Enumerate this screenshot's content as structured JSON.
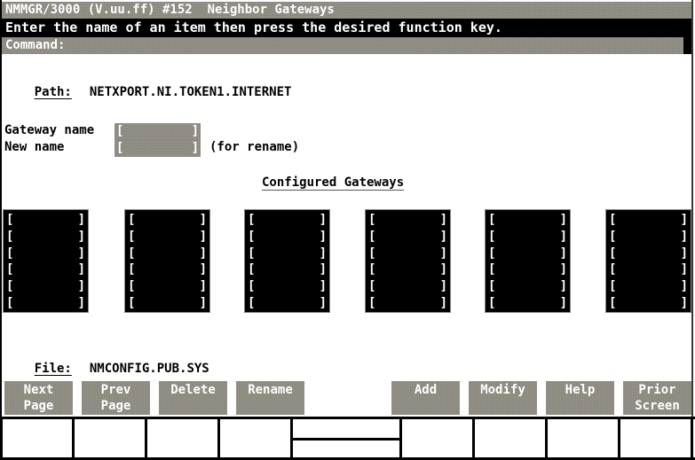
{
  "header": {
    "title": "NMMGR/3000 (V.uu.ff) #152  Neighbor Gateways",
    "message": "Enter the name of an item then press the desired function key.",
    "command_label": "Command:"
  },
  "path": {
    "label": "Path:",
    "value": "NETXPORT.NI.TOKEN1.INTERNET"
  },
  "form": {
    "gateway_name_label": "Gateway name",
    "gateway_name_value": "",
    "new_name_label": "New name",
    "new_name_value": "",
    "rename_note": "(for rename)",
    "bracket_open": "[",
    "bracket_close": "]"
  },
  "configured": {
    "title": "Configured Gateways",
    "columns": [
      {
        "slots": [
          "",
          "",
          "",
          "",
          "",
          ""
        ]
      },
      {
        "slots": [
          "",
          "",
          "",
          "",
          "",
          ""
        ]
      },
      {
        "slots": [
          "",
          "",
          "",
          "",
          "",
          ""
        ]
      },
      {
        "slots": [
          "",
          "",
          "",
          "",
          "",
          ""
        ]
      },
      {
        "slots": [
          "",
          "",
          "",
          "",
          "",
          ""
        ]
      },
      {
        "slots": [
          "",
          "",
          "",
          "",
          "",
          ""
        ]
      }
    ]
  },
  "file": {
    "label": "File:",
    "value": "NMCONFIG.PUB.SYS"
  },
  "softkeys": [
    {
      "label": "Next\nPage"
    },
    {
      "label": "Prev\nPage"
    },
    {
      "label": "Delete"
    },
    {
      "label": "Rename"
    },
    {
      "label": "Add"
    },
    {
      "label": "Modify"
    },
    {
      "label": "Help"
    },
    {
      "label": "Prior\nScreen"
    }
  ],
  "colors": {
    "field_bg": "#8e8a7a",
    "message_bg": "#000000",
    "text_on_dark": "#ffffff"
  }
}
